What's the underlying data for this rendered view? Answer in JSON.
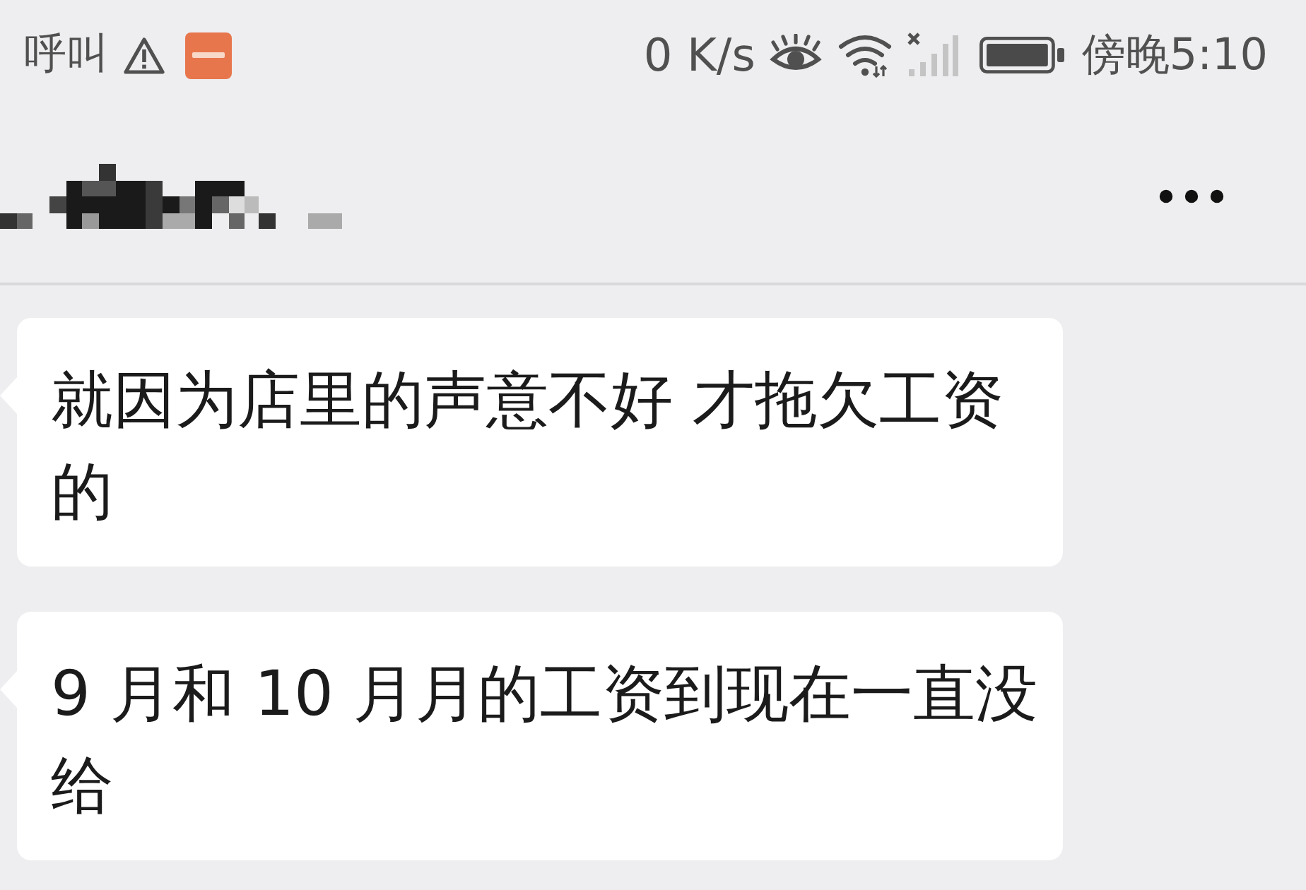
{
  "status_bar": {
    "notification_text": "呼叫",
    "network_speed": "0 K/s",
    "time": "傍晚5:10"
  },
  "messages": [
    {
      "text": "就因为店里的声意不好 才拖欠工资的"
    },
    {
      "text": "9 月和 10 月月的工资到现在一直没给"
    }
  ]
}
